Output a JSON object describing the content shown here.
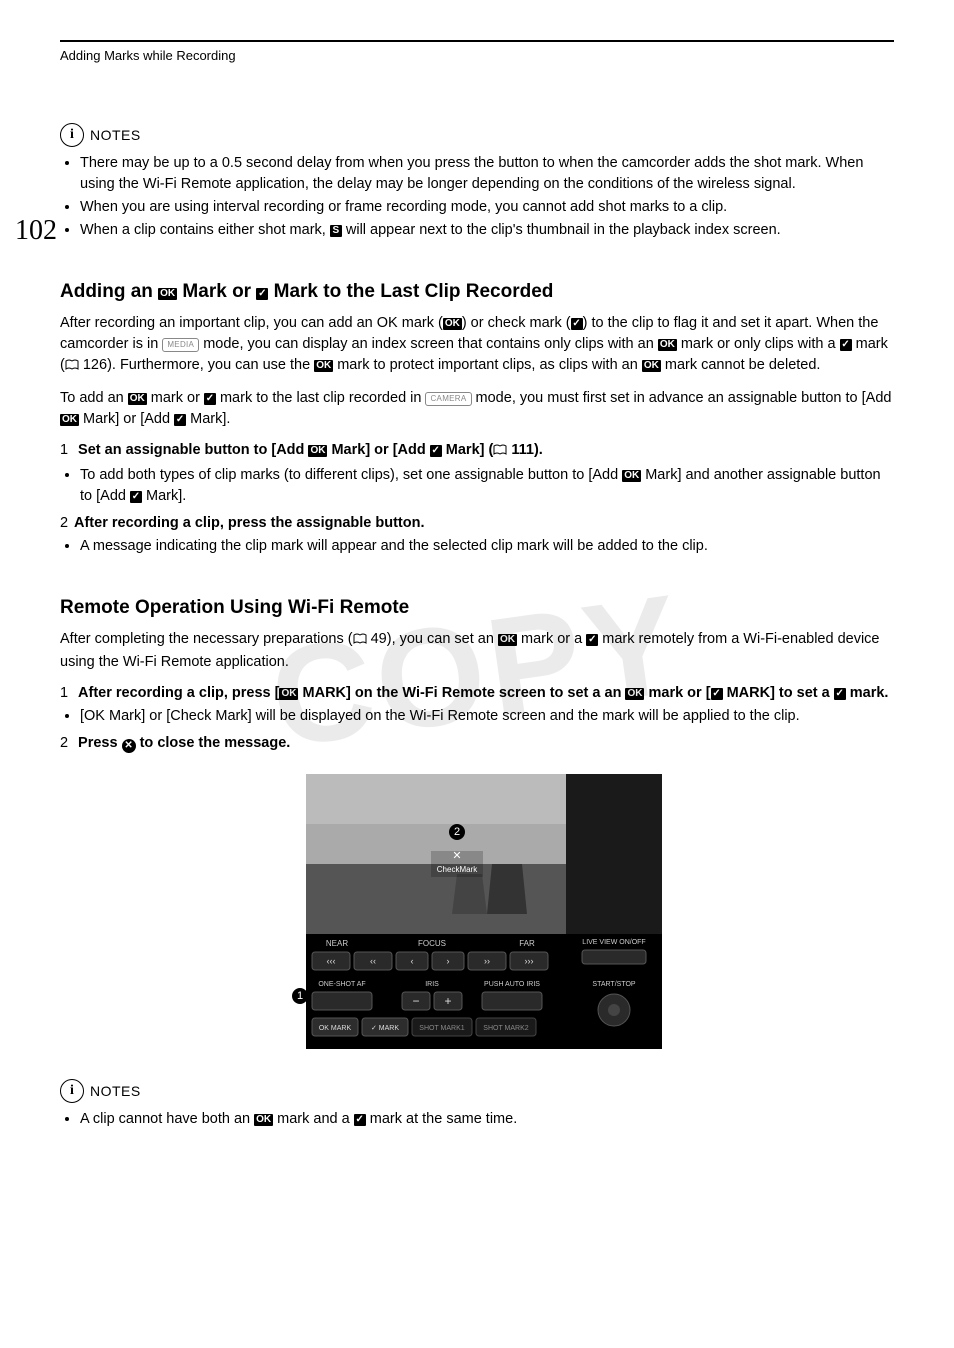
{
  "page": {
    "number": "102",
    "running_header": "Adding Marks while Recording"
  },
  "watermark": "COPY",
  "notes_label": "NOTES",
  "icons": {
    "ok": "OK",
    "check": "✓",
    "s": "S",
    "mode_media": "MEDIA",
    "mode_camera": "CAMERA",
    "x": "✕"
  },
  "notes1": {
    "b1": "There may be up to a 0.5 second delay from when you press the button to when the camcorder adds the shot mark. When using the Wi-Fi Remote application, the delay may be longer depending on the conditions of the wireless signal.",
    "b2": "When you are using interval recording or frame recording mode, you cannot add shot marks to a clip.",
    "b3_a": "When a clip contains either shot mark, ",
    "b3_b": " will appear next to the clip's thumbnail in the playback index screen."
  },
  "section1": {
    "title_a": "Adding an ",
    "title_b": " Mark or ",
    "title_c": " Mark to the Last Clip Recorded",
    "p1_a": "After recording an important clip, you can add an OK mark (",
    "p1_b": ") or check mark (",
    "p1_c": ") to the clip to flag it and set it apart. When the camcorder is in ",
    "p1_d": " mode, you can display an index screen that contains only clips with an ",
    "p1_e": " mark or only clips with a ",
    "p1_f": " mark (",
    "p1_ref": " 126). Furthermore, you can use the ",
    "p1_g": " mark to protect important clips, as clips with an ",
    "p1_h": " mark cannot be deleted.",
    "p2_a": "To add an ",
    "p2_b": " mark or ",
    "p2_c": " mark to the last clip recorded in ",
    "p2_d": " mode, you must first set in advance an assignable button to [Add ",
    "p2_e": " Mark] or [Add ",
    "p2_f": " Mark].",
    "step1_a": "Set an assignable button to [Add ",
    "step1_b": " Mark] or [Add ",
    "step1_c": " Mark] (",
    "step1_ref": " 111).",
    "step1_sub_a": "To add both types of clip marks (to different clips), set one assignable button to [Add ",
    "step1_sub_b": " Mark] and another assignable button to [Add ",
    "step1_sub_c": " Mark].",
    "step2": "After recording a clip, press the assignable button.",
    "step2_sub": "A message indicating the clip mark will appear and the selected clip mark will be added to the clip."
  },
  "section2": {
    "title": "Remote Operation Using Wi-Fi Remote",
    "p1_a": "After completing the necessary preparations (",
    "p1_ref": " 49), you can set an ",
    "p1_b": " mark or a ",
    "p1_c": " mark remotely from a Wi-Fi-enabled device using the Wi-Fi Remote application.",
    "step1_a": "After recording a clip, press [",
    "step1_b": " MARK] on the Wi-Fi Remote screen to set a an ",
    "step1_c": " mark or [",
    "step1_d": " MARK] to set a ",
    "step1_e": " mark.",
    "step1_sub": "[OK Mark] or [Check Mark] will be displayed on the Wi-Fi Remote screen and the mark will be applied to the clip.",
    "step2_a": "Press ",
    "step2_b": " to close the message."
  },
  "wifi_screenshot": {
    "overlay_label": "CheckMark",
    "near": "NEAR",
    "focus": "FOCUS",
    "far": "FAR",
    "live_view": "LIVE VIEW ON/OFF",
    "oneshot": "ONE-SHOT AF",
    "iris": "IRIS",
    "push_auto": "PUSH AUTO IRIS",
    "startstop": "START/STOP",
    "okmark": "OK MARK",
    "checkmark": "✓ MARK",
    "shot1": "SHOT MARK1",
    "shot2": "SHOT MARK2",
    "callout1": "1",
    "callout2": "2"
  },
  "notes2": {
    "b1_a": "A clip cannot have both an ",
    "b1_b": " mark and a ",
    "b1_c": " mark at the same time."
  }
}
